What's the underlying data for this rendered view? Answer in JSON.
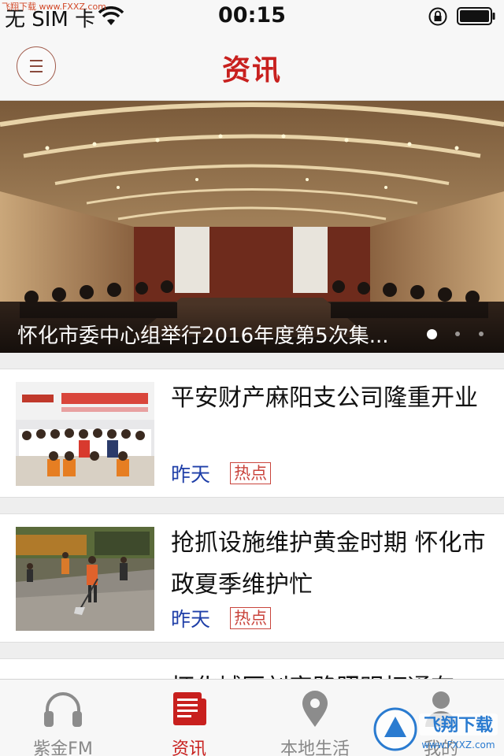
{
  "status_bar": {
    "carrier": "无 SIM 卡",
    "time": "00:15"
  },
  "nav": {
    "title": "资讯",
    "menu_icon": "menu-icon"
  },
  "banner": {
    "title": "怀化市委中心组举行2016年度第5次集...",
    "page_count": 3,
    "active_page": 1
  },
  "news": [
    {
      "title": "平安财产麻阳支公司隆重开业",
      "time": "昨天",
      "tag": "热点"
    },
    {
      "title": "抢抓设施维护黄金时期 怀化市政夏季维护忙",
      "time": "昨天",
      "tag": "热点"
    },
    {
      "title": "怀化城区刘家路照明灯通有"
    }
  ],
  "tabs": [
    {
      "label": "紫金FM",
      "icon": "headphones-icon",
      "active": false
    },
    {
      "label": "资讯",
      "icon": "newspaper-icon",
      "active": true
    },
    {
      "label": "本地生活",
      "icon": "location-pin-icon",
      "active": false
    },
    {
      "label": "我的",
      "icon": "person-icon",
      "active": false
    }
  ],
  "watermark": {
    "top_text": "飞翔下载 www.FXXZ.com",
    "logo_text": "飞翔下载",
    "logo_url": "www.FXXZ.com"
  },
  "colors": {
    "accent": "#c8201e",
    "time_blue": "#1f3fa8",
    "tag_red": "#c9443c"
  }
}
